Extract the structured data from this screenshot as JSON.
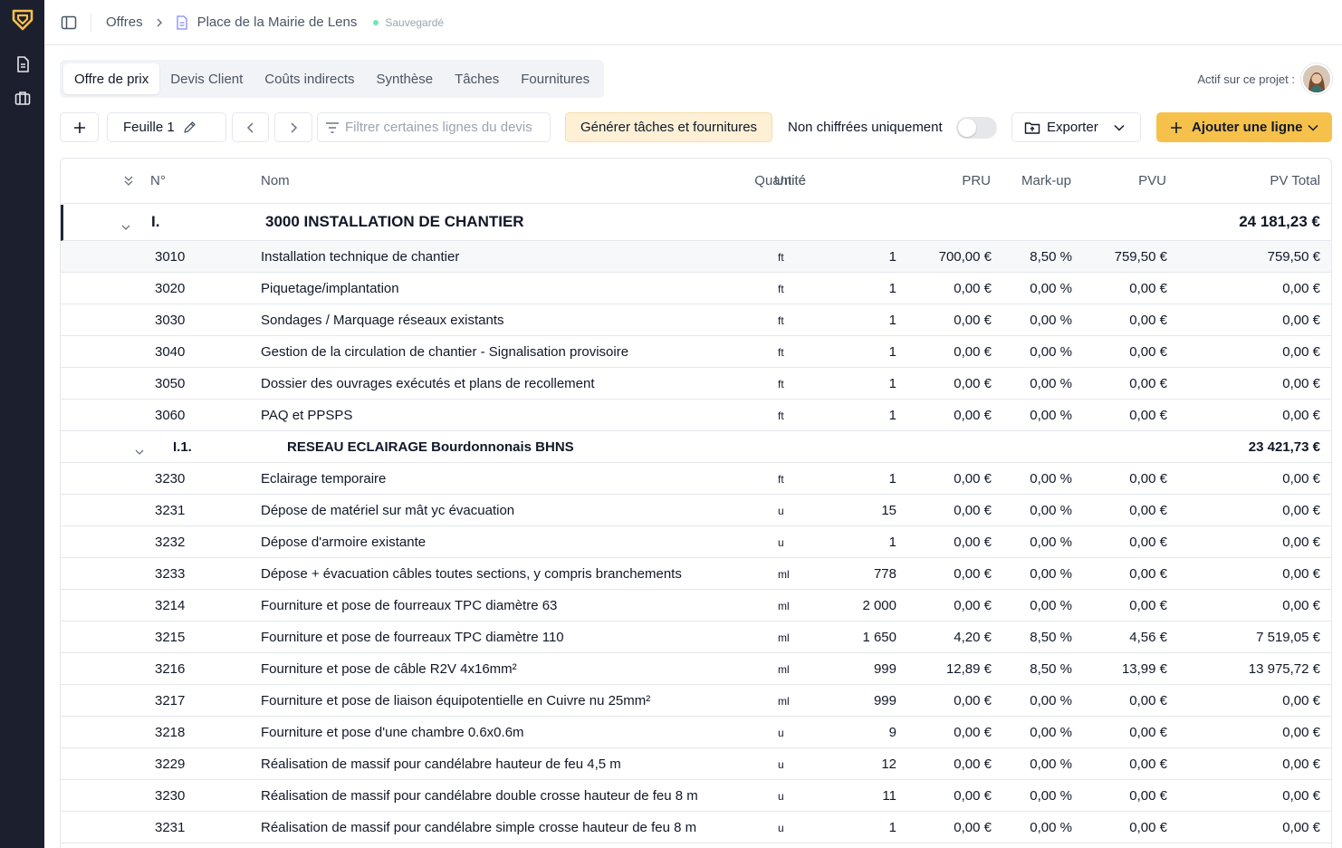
{
  "breadcrumb": {
    "root": "Offres",
    "project": "Place de la Mairie de Lens",
    "status": "Sauvegardé"
  },
  "tabs": [
    "Offre de prix",
    "Devis Client",
    "Coûts indirects",
    "Synthèse",
    "Tâches",
    "Fournitures"
  ],
  "active_label": "Actif sur ce projet :",
  "toolbar": {
    "sheet": "Feuille 1",
    "filter_placeholder": "Filtrer certaines lignes du devis",
    "generate": "Générer tâches et fournitures",
    "toggle_label": "Non chiffrées uniquement",
    "export": "Exporter",
    "add_line": "Ajouter une ligne"
  },
  "columns": {
    "num": "N°",
    "name": "Nom",
    "unit": "Unité",
    "qty": "Quantité",
    "pru": "PRU",
    "markup": "Mark-up",
    "pvu": "PVU",
    "total": "PV Total"
  },
  "colors": {
    "accent": "#f6c14b",
    "sidebar": "#1c1f2e"
  },
  "group1": {
    "num": "I.",
    "name": "3000 INSTALLATION DE CHANTIER",
    "total": "24 181,23 €"
  },
  "items1": [
    {
      "num": "3010",
      "name": "Installation technique de chantier",
      "unit": "ft",
      "qty": "1",
      "pru": "700,00 €",
      "markup": "8,50 %",
      "pvu": "759,50 €",
      "total": "759,50 €"
    },
    {
      "num": "3020",
      "name": "Piquetage/implantation",
      "unit": "ft",
      "qty": "1",
      "pru": "0,00 €",
      "markup": "0,00 %",
      "pvu": "0,00 €",
      "total": "0,00 €"
    },
    {
      "num": "3030",
      "name": "Sondages  / Marquage réseaux existants",
      "unit": "ft",
      "qty": "1",
      "pru": "0,00 €",
      "markup": "0,00 %",
      "pvu": "0,00 €",
      "total": "0,00 €"
    },
    {
      "num": "3040",
      "name": "Gestion de la circulation de chantier - Signalisation provisoire",
      "unit": "ft",
      "qty": "1",
      "pru": "0,00 €",
      "markup": "0,00 %",
      "pvu": "0,00 €",
      "total": "0,00 €"
    },
    {
      "num": "3050",
      "name": "Dossier des ouvrages exécutés et plans de recollement",
      "unit": "ft",
      "qty": "1",
      "pru": "0,00 €",
      "markup": "0,00 %",
      "pvu": "0,00 €",
      "total": "0,00 €"
    },
    {
      "num": "3060",
      "name": "PAQ et PPSPS",
      "unit": "ft",
      "qty": "1",
      "pru": "0,00 €",
      "markup": "0,00 %",
      "pvu": "0,00 €",
      "total": "0,00 €"
    }
  ],
  "group2": {
    "num": "I.1.",
    "name": "RESEAU ECLAIRAGE Bourdonnonais BHNS",
    "total": "23 421,73 €"
  },
  "items2": [
    {
      "num": "3230",
      "name": "Eclairage temporaire",
      "unit": "ft",
      "qty": "1",
      "pru": "0,00 €",
      "markup": "0,00 %",
      "pvu": "0,00 €",
      "total": "0,00 €"
    },
    {
      "num": "3231",
      "name": "Dépose de matériel sur mât yc évacuation",
      "unit": "u",
      "qty": "15",
      "pru": "0,00 €",
      "markup": "0,00 %",
      "pvu": "0,00 €",
      "total": "0,00 €"
    },
    {
      "num": "3232",
      "name": "Dépose d'armoire existante",
      "unit": "u",
      "qty": "1",
      "pru": "0,00 €",
      "markup": "0,00 %",
      "pvu": "0,00 €",
      "total": "0,00 €"
    },
    {
      "num": "3233",
      "name": "Dépose + évacuation câbles toutes sections, y compris branchements",
      "unit": "ml",
      "qty": "778",
      "pru": "0,00 €",
      "markup": "0,00 %",
      "pvu": "0,00 €",
      "total": "0,00 €"
    },
    {
      "num": "3214",
      "name": "Fourniture et pose de fourreaux TPC diamètre 63",
      "unit": "ml",
      "qty": "2 000",
      "pru": "0,00 €",
      "markup": "0,00 %",
      "pvu": "0,00 €",
      "total": "0,00 €"
    },
    {
      "num": "3215",
      "name": "Fourniture et pose de fourreaux TPC diamètre 110",
      "unit": "ml",
      "qty": "1 650",
      "pru": "4,20 €",
      "markup": "8,50 %",
      "pvu": "4,56 €",
      "total": "7 519,05 €"
    },
    {
      "num": "3216",
      "name": "Fourniture et pose de câble R2V 4x16mm²",
      "unit": "ml",
      "qty": "999",
      "pru": "12,89 €",
      "markup": "8,50 %",
      "pvu": "13,99 €",
      "total": "13 975,72 €"
    },
    {
      "num": "3217",
      "name": "Fourniture et pose de liaison équipotentielle en Cuivre nu 25mm²",
      "unit": "ml",
      "qty": "999",
      "pru": "0,00 €",
      "markup": "0,00 %",
      "pvu": "0,00 €",
      "total": "0,00 €"
    },
    {
      "num": "3218",
      "name": "Fourniture et pose d'une chambre 0.6x0.6m",
      "unit": "u",
      "qty": "9",
      "pru": "0,00 €",
      "markup": "0,00 %",
      "pvu": "0,00 €",
      "total": "0,00 €"
    },
    {
      "num": "3229",
      "name": "Réalisation de massif pour candélabre hauteur de feu 4,5 m",
      "unit": "u",
      "qty": "12",
      "pru": "0,00 €",
      "markup": "0,00 %",
      "pvu": "0,00 €",
      "total": "0,00 €"
    },
    {
      "num": "3230",
      "name": "Réalisation de massif pour candélabre double crosse hauteur de feu 8 m",
      "unit": "u",
      "qty": "11",
      "pru": "0,00 €",
      "markup": "0,00 %",
      "pvu": "0,00 €",
      "total": "0,00 €"
    },
    {
      "num": "3231",
      "name": "Réalisation de massif pour candélabre simple crosse hauteur de feu 8 m",
      "unit": "u",
      "qty": "1",
      "pru": "0,00 €",
      "markup": "0,00 %",
      "pvu": "0,00 €",
      "total": "0,00 €"
    }
  ]
}
